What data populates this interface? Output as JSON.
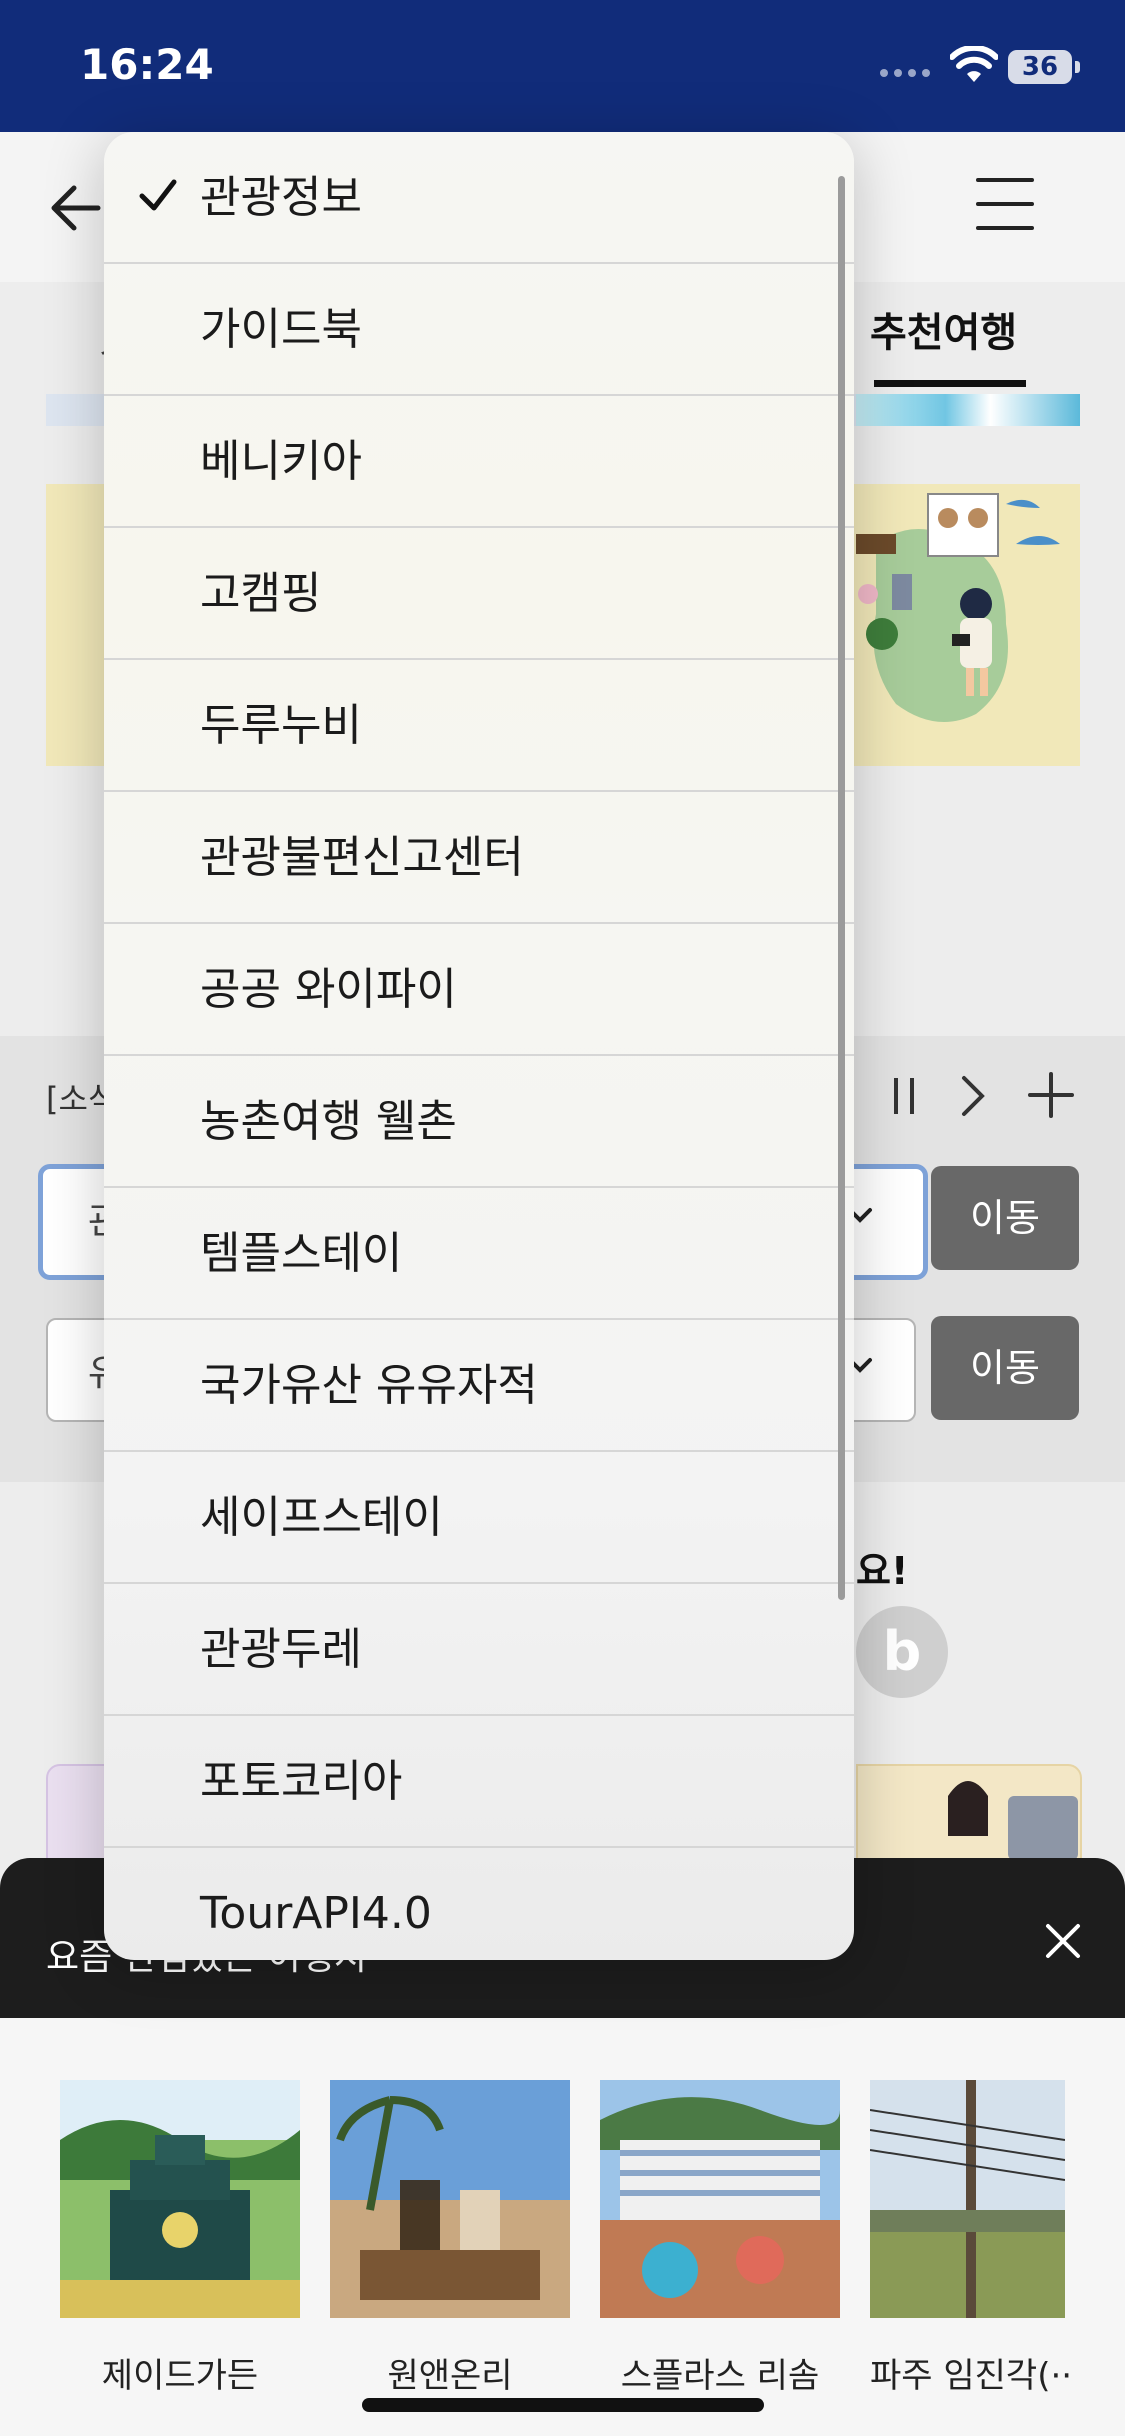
{
  "status_bar": {
    "time": "16:24",
    "battery": "36"
  },
  "tabs": {
    "active": "추천여행",
    "partial_left": "ㅅ"
  },
  "news": {
    "partial": "[소식"
  },
  "selects": {
    "first_partial": "관",
    "second_partial": "유",
    "go_label": "이동"
  },
  "promo": {
    "text_partial": "요!",
    "b_icon_glyph": "b"
  },
  "recent_bar": {
    "text": "요즘 관심있는 여행지"
  },
  "dropdown": {
    "selected": "관광정보",
    "items": [
      "관광정보",
      "가이드북",
      "베니키아",
      "고캠핑",
      "두루누비",
      "관광불편신고센터",
      "공공 와이파이",
      "농촌여행 웰촌",
      "템플스테이",
      "국가유산 유유자적",
      "세이프스테이",
      "관광두레",
      "포토코리아",
      "TourAPI4.0"
    ]
  },
  "recent_places": [
    {
      "label": "제이드가든"
    },
    {
      "label": "원앤온리"
    },
    {
      "label": "스플라스 리솜"
    },
    {
      "label": "파주 임진각(··"
    }
  ],
  "colors": {
    "status_bar": "#112c7a",
    "go_button": "#686868",
    "select_focus": "#7ea2d8"
  }
}
